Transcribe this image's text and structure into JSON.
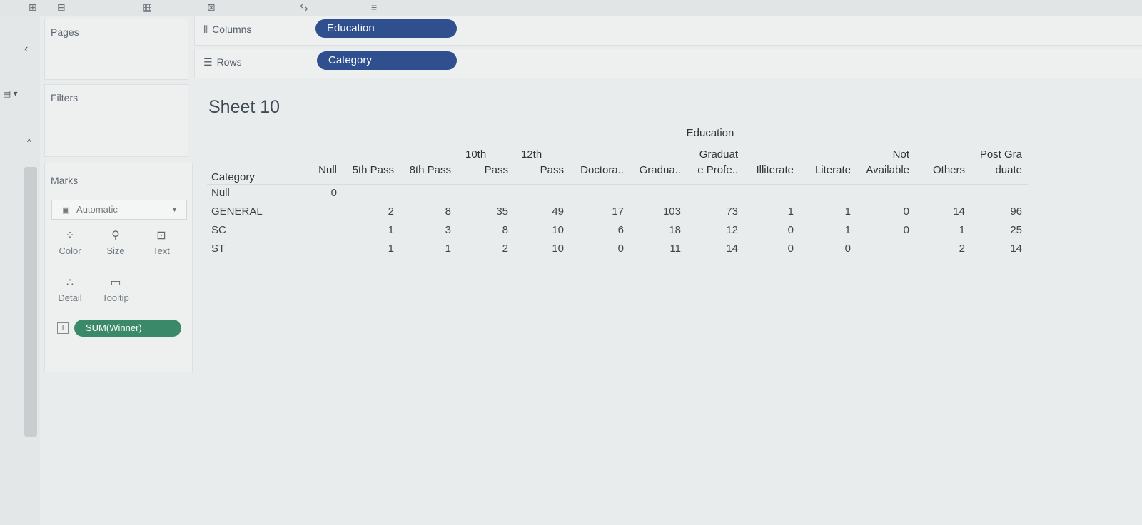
{
  "shelves": {
    "columns": {
      "label": "Columns",
      "pill": "Education"
    },
    "rows": {
      "label": "Rows",
      "pill": "Category"
    }
  },
  "panels": {
    "pages": "Pages",
    "filters": "Filters",
    "marks": "Marks"
  },
  "marks": {
    "dropdown": "Automatic",
    "cards": [
      {
        "label": "Color",
        "icon": "color-dots-icon"
      },
      {
        "label": "Size",
        "icon": "size-icon"
      },
      {
        "label": "Text",
        "icon": "text-icon"
      },
      {
        "label": "Detail",
        "icon": "detail-icon"
      },
      {
        "label": "Tooltip",
        "icon": "tooltip-icon"
      }
    ],
    "field": "SUM(Winner)"
  },
  "sheet": {
    "title": "Sheet 10"
  },
  "table": {
    "column_group": "Education",
    "row_header": "Category",
    "columns": [
      [
        "Null"
      ],
      [
        "5th Pass"
      ],
      [
        "8th Pass"
      ],
      [
        "10th",
        "Pass"
      ],
      [
        "12th",
        "Pass"
      ],
      [
        "Doctora.."
      ],
      [
        "Gradua.."
      ],
      [
        "Graduat",
        "e Profe.."
      ],
      [
        "Illiterate"
      ],
      [
        "Literate"
      ],
      [
        "Not",
        "Available"
      ],
      [
        "Others"
      ],
      [
        "Post Gra",
        "duate"
      ]
    ],
    "rows": [
      {
        "label": "Null",
        "values": [
          "0",
          "",
          "",
          "",
          "",
          "",
          "",
          "",
          "",
          "",
          "",
          "",
          ""
        ]
      },
      {
        "label": "GENERAL",
        "values": [
          "",
          "2",
          "8",
          "35",
          "49",
          "17",
          "103",
          "73",
          "1",
          "1",
          "0",
          "14",
          "96"
        ]
      },
      {
        "label": "SC",
        "values": [
          "",
          "1",
          "3",
          "8",
          "10",
          "6",
          "18",
          "12",
          "0",
          "1",
          "0",
          "1",
          "25"
        ]
      },
      {
        "label": "ST",
        "values": [
          "",
          "1",
          "1",
          "2",
          "10",
          "0",
          "11",
          "14",
          "0",
          "0",
          "",
          "2",
          "14"
        ]
      }
    ]
  }
}
